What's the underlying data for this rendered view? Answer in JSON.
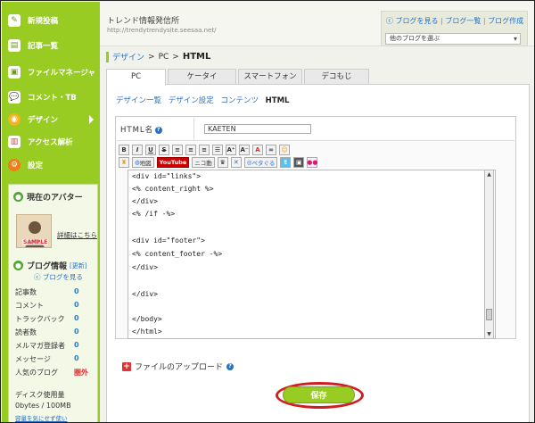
{
  "sidebar": {
    "nav": [
      {
        "label": "新規投稿",
        "icon": "new-post-icon",
        "active": false
      },
      {
        "label": "記事一覧",
        "icon": "article-list-icon",
        "active": false
      },
      {
        "label": "ファイルマネージャ",
        "icon": "file-manager-icon",
        "active": false
      },
      {
        "label": "コメント・TB",
        "icon": "comment-icon",
        "active": false
      },
      {
        "label": "デザイン",
        "icon": "design-icon",
        "active": true
      },
      {
        "label": "アクセス解析",
        "icon": "access-analytics-icon",
        "active": false
      },
      {
        "label": "設定",
        "icon": "settings-icon",
        "active": false
      }
    ],
    "avatar_heading": "現在のアバター",
    "avatar_sample": "SAMPLE",
    "avatar_link": "詳細はこちら",
    "blog_info_heading": "ブログ情報",
    "update_link": "[更新]",
    "view_blog_link": "ブログを見る",
    "stats": [
      {
        "label": "記事数",
        "value": "0"
      },
      {
        "label": "コメント",
        "value": "0"
      },
      {
        "label": "トラックバック",
        "value": "0"
      },
      {
        "label": "読者数",
        "value": "0"
      },
      {
        "label": "メルマガ登録者",
        "value": "0"
      },
      {
        "label": "メッセージ",
        "value": "0"
      },
      {
        "label": "人気のブログ",
        "value": "圏外"
      }
    ],
    "disk_label": "ディスク使用量",
    "disk_value": "0bytes / 100MB",
    "disk_link": "容量を気にせず使い"
  },
  "header": {
    "blog_name": "トレンド情報発信所",
    "blog_url": "http://trendytrendysite.seesaa.net/",
    "links": [
      "ブログを見る",
      "ブログ一覧",
      "ブログ作成"
    ],
    "blog_select": "他のブログを選ぶ"
  },
  "breadcrumb": {
    "design": "デザイン",
    "sep": ">",
    "pc": "PC",
    "current": "HTML"
  },
  "tabs": [
    "PC",
    "ケータイ",
    "スマートフォン",
    "デコもじ"
  ],
  "subnav": [
    "デザイン一覧",
    "デザイン設定",
    "コンテンツ",
    "HTML"
  ],
  "editor": {
    "name_label": "HTML名",
    "name_value": "KAETEN",
    "toolbar_row2": [
      "地図",
      "YouTube",
      "ニコ動",
      "ぺタぐる"
    ],
    "code_lines": [
      "<div id=\"links\">",
      "<% content_right %>",
      "</div>",
      "<% /if -%>",
      "",
      "<div id=\"footer\">",
      "<% content_footer -%>",
      "</div>",
      "",
      "</div>",
      "",
      "</body>",
      "</html>"
    ]
  },
  "upload_label": "ファイルのアップロード",
  "save_label": "保存",
  "colors": {
    "brand_green": "#99cc22",
    "link_blue": "#2a6fc4",
    "highlight_red": "#d11d1d"
  }
}
